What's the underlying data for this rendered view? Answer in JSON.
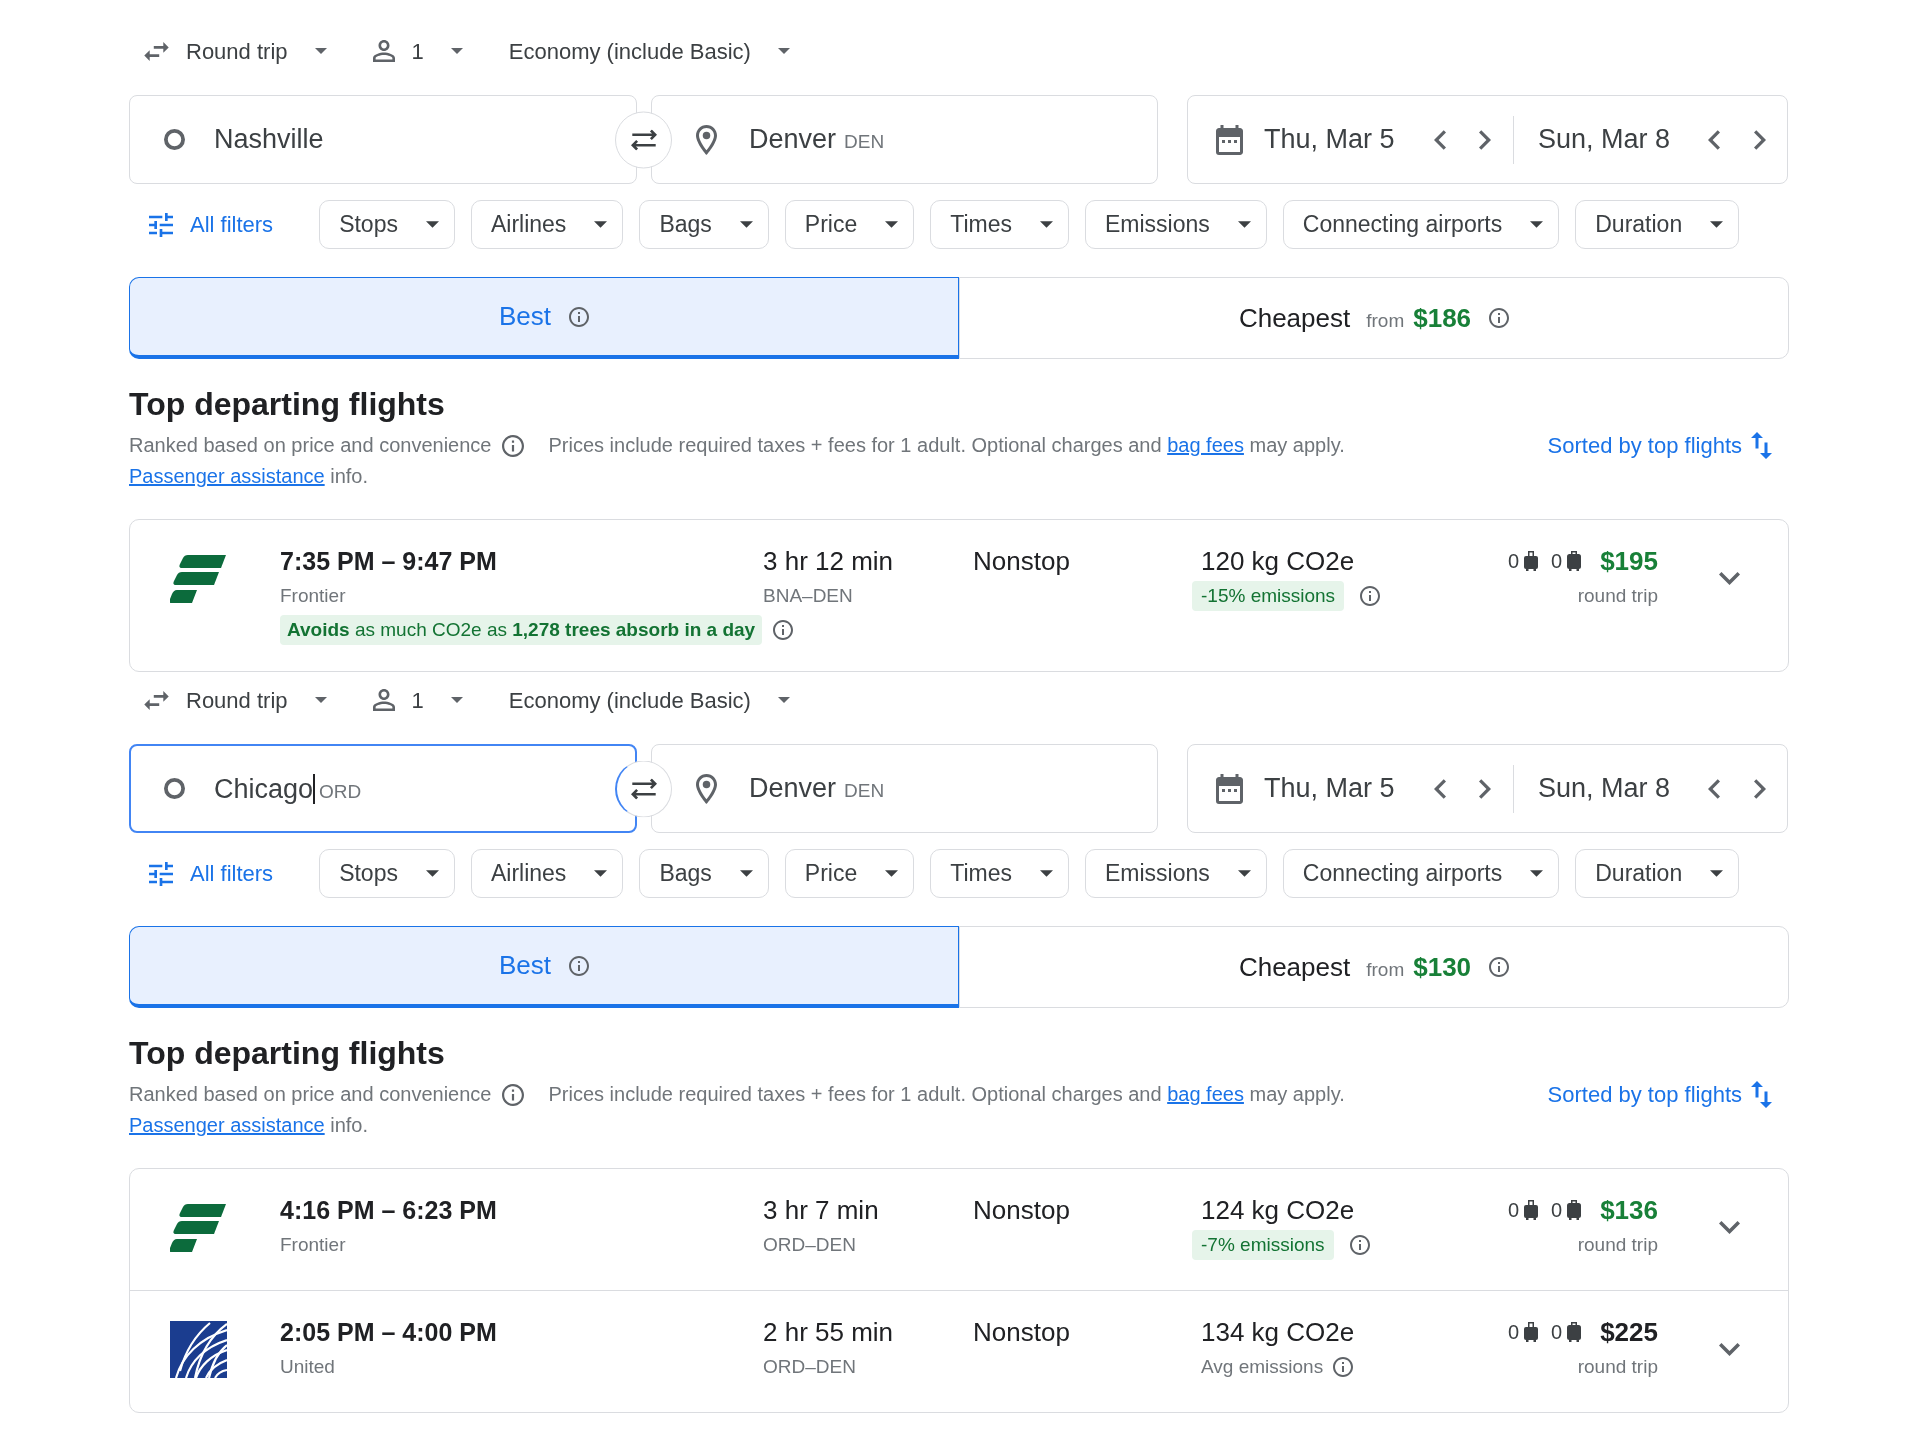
{
  "panels": [
    {
      "trip_options": [
        {
          "kind": "trip_type",
          "label": "Round trip"
        },
        {
          "kind": "passengers",
          "label": "1"
        },
        {
          "kind": "cabin",
          "label": "Economy (include Basic)"
        }
      ],
      "origin": {
        "value": "Nashville",
        "focused": false
      },
      "destination": {
        "value": "Denver",
        "code": "DEN"
      },
      "dates": {
        "departure": "Thu, Mar 5",
        "return": "Sun, Mar 8"
      },
      "all_filters": "All filters",
      "filters": [
        "Stops",
        "Airlines",
        "Bags",
        "Price",
        "Times",
        "Emissions",
        "Connecting airports",
        "Duration"
      ],
      "tabs": [
        {
          "label": "Best",
          "selected": true
        },
        {
          "label": "Cheapest",
          "selected": false,
          "from_label": "from",
          "price": "$186"
        }
      ],
      "heading": "Top departing flights",
      "ranking_note": "Ranked based on price and convenience",
      "pricing_note": {
        "text": "Prices include required taxes + fees for 1 adult. Optional charges and",
        "link": "bag fees",
        "text_after": "may apply."
      },
      "assistance_note": {
        "link": "Passenger assistance",
        "text_after": "info."
      },
      "sort": "Sorted by top flights",
      "flights": [
        {
          "kind": "stripes",
          "times": "7:35 PM – 9:47 PM",
          "airline": "Frontier",
          "duration": "3 hr 12 min",
          "route": "BNA–DEN",
          "stops": "Nonstop",
          "emissions": "120 kg CO2e",
          "emissions_note": {
            "kind": "lower",
            "text": "-15% emissions"
          },
          "carry_on_bags": "0",
          "checked_bags": "0",
          "price": "$195",
          "price_highlighted": true,
          "price_note": "round trip",
          "eco_note": "**Avoids** as much CO2e as **1,278 trees absorb in a day**",
          "expanded": false
        }
      ]
    },
    {
      "trip_options": [
        {
          "kind": "trip_type",
          "label": "Round trip"
        },
        {
          "kind": "passengers",
          "label": "1"
        },
        {
          "kind": "cabin",
          "label": "Economy (include Basic)"
        }
      ],
      "origin": {
        "value": "Chicago",
        "code": "ORD",
        "focused": true
      },
      "destination": {
        "value": "Denver",
        "code": "DEN"
      },
      "dates": {
        "departure": "Thu, Mar 5",
        "return": "Sun, Mar 8"
      },
      "all_filters": "All filters",
      "filters": [
        "Stops",
        "Airlines",
        "Bags",
        "Price",
        "Times",
        "Emissions",
        "Connecting airports",
        "Duration"
      ],
      "tabs": [
        {
          "label": "Best",
          "selected": true
        },
        {
          "label": "Cheapest",
          "selected": false,
          "from_label": "from",
          "price": "$130"
        }
      ],
      "heading": "Top departing flights",
      "ranking_note": "Ranked based on price and convenience",
      "pricing_note": {
        "text": "Prices include required taxes + fees for 1 adult. Optional charges and",
        "link": "bag fees",
        "text_after": "may apply."
      },
      "assistance_note": {
        "link": "Passenger assistance",
        "text_after": "info."
      },
      "sort": "Sorted by top flights",
      "flights": [
        {
          "kind": "stripes",
          "times": "4:16 PM – 6:23 PM",
          "airline": "Frontier",
          "duration": "3 hr 7 min",
          "route": "ORD–DEN",
          "stops": "Nonstop",
          "emissions": "124 kg CO2e",
          "emissions_note": {
            "kind": "lower",
            "text": "-7% emissions"
          },
          "carry_on_bags": "0",
          "checked_bags": "0",
          "price": "$136",
          "price_highlighted": true,
          "price_note": "round trip",
          "expanded": false
        },
        {
          "kind": "globe",
          "times": "2:05 PM – 4:00 PM",
          "airline": "United",
          "duration": "2 hr 55 min",
          "route": "ORD–DEN",
          "stops": "Nonstop",
          "emissions": "134 kg CO2e",
          "emissions_note": {
            "kind": "average",
            "text": "Avg emissions"
          },
          "carry_on_bags": "0",
          "checked_bags": "0",
          "price": "$225",
          "price_highlighted": false,
          "price_note": "round trip",
          "expanded": false
        }
      ]
    }
  ]
}
